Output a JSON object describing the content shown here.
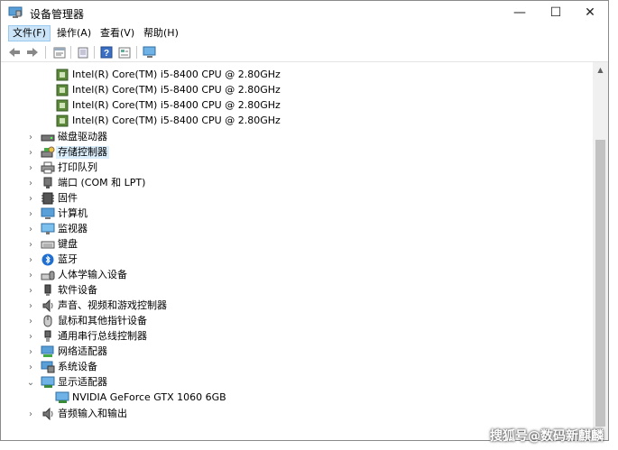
{
  "window": {
    "title": "设备管理器"
  },
  "controls": {
    "minimize": "—",
    "maximize": "☐",
    "close": "✕"
  },
  "menu": [
    {
      "label": "文件(F)",
      "active": true
    },
    {
      "label": "操作(A)"
    },
    {
      "label": "查看(V)"
    },
    {
      "label": "帮助(H)"
    }
  ],
  "toolbar": {
    "icons": [
      "back-arrow-icon",
      "forward-arrow-icon",
      "properties-icon",
      "update-driver-icon",
      "help-icon",
      "view-icon",
      "monitor-scan-icon"
    ]
  },
  "tree": {
    "cpu_items": [
      "Intel(R) Core(TM) i5-8400 CPU @ 2.80GHz",
      "Intel(R) Core(TM) i5-8400 CPU @ 2.80GHz",
      "Intel(R) Core(TM) i5-8400 CPU @ 2.80GHz",
      "Intel(R) Core(TM) i5-8400 CPU @ 2.80GHz"
    ],
    "categories": [
      {
        "label": "磁盘驱动器",
        "icon": "disk-drive-icon"
      },
      {
        "label": "存储控制器",
        "icon": "storage-controller-icon",
        "selected": true
      },
      {
        "label": "打印队列",
        "icon": "printer-icon"
      },
      {
        "label": "端口 (COM 和 LPT)",
        "icon": "port-icon"
      },
      {
        "label": "固件",
        "icon": "firmware-icon"
      },
      {
        "label": "计算机",
        "icon": "computer-icon"
      },
      {
        "label": "监视器",
        "icon": "monitor-icon"
      },
      {
        "label": "键盘",
        "icon": "keyboard-icon"
      },
      {
        "label": "蓝牙",
        "icon": "bluetooth-icon"
      },
      {
        "label": "人体学输入设备",
        "icon": "hid-icon"
      },
      {
        "label": "软件设备",
        "icon": "software-device-icon"
      },
      {
        "label": "声音、视频和游戏控制器",
        "icon": "speaker-icon"
      },
      {
        "label": "鼠标和其他指针设备",
        "icon": "mouse-icon"
      },
      {
        "label": "通用串行总线控制器",
        "icon": "usb-icon"
      },
      {
        "label": "网络适配器",
        "icon": "network-adapter-icon"
      },
      {
        "label": "系统设备",
        "icon": "system-device-icon"
      },
      {
        "label": "显示适配器",
        "icon": "display-adapter-icon",
        "expanded": true
      },
      {
        "label": "NVIDIA GeForce GTX 1060 6GB",
        "icon": "gpu-icon",
        "child": true
      },
      {
        "label": "音频输入和输出",
        "icon": "audio-io-icon"
      }
    ]
  },
  "watermark": "搜狐号@数码新麒麟",
  "colors": {
    "selection": "#dbeefb",
    "menu_active": "#cce4f7",
    "accent": "#0078d7"
  }
}
